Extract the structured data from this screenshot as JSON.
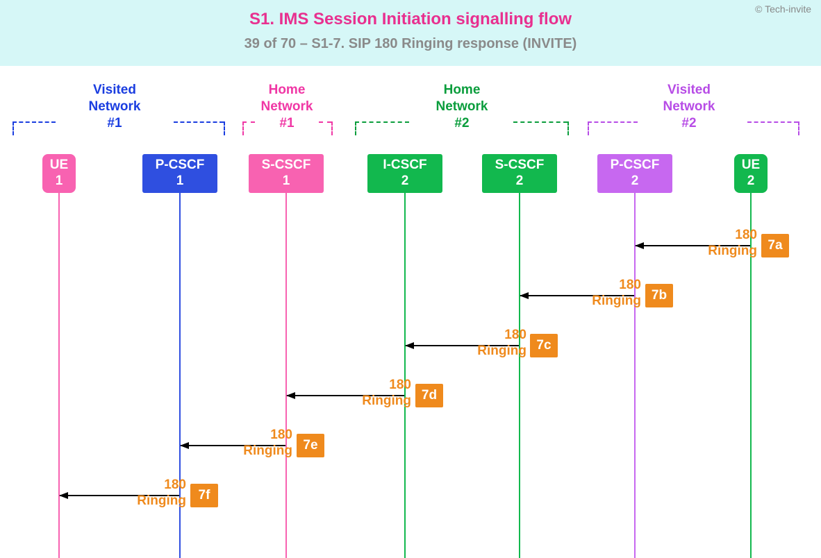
{
  "header": {
    "title": "S1. IMS Session Initiation signalling flow",
    "subtitle": "39 of 70 – S1-7. SIP 180 Ringing response (INVITE)",
    "copyright": "© Tech-invite"
  },
  "groups": {
    "visited1": {
      "line1": "Visited",
      "line2": "Network",
      "line3": "#1"
    },
    "home1": {
      "line1": "Home",
      "line2": "Network",
      "line3": "#1"
    },
    "home2": {
      "line1": "Home",
      "line2": "Network",
      "line3": "#2"
    },
    "visited2": {
      "line1": "Visited",
      "line2": "Network",
      "line3": "#2"
    }
  },
  "nodes": {
    "ue1": {
      "l1": "UE",
      "l2": "1"
    },
    "pcscf1": {
      "l1": "P-CSCF",
      "l2": "1"
    },
    "scscf1": {
      "l1": "S-CSCF",
      "l2": "1"
    },
    "icscf2": {
      "l1": "I-CSCF",
      "l2": "2"
    },
    "scscf2": {
      "l1": "S-CSCF",
      "l2": "2"
    },
    "pcscf2": {
      "l1": "P-CSCF",
      "l2": "2"
    },
    "ue2": {
      "l1": "UE",
      "l2": "2"
    }
  },
  "messages": {
    "a": {
      "top": "180",
      "bottom": "Ringing",
      "tag": "7a"
    },
    "b": {
      "top": "180",
      "bottom": "Ringing",
      "tag": "7b"
    },
    "c": {
      "top": "180",
      "bottom": "Ringing",
      "tag": "7c"
    },
    "d": {
      "top": "180",
      "bottom": "Ringing",
      "tag": "7d"
    },
    "e": {
      "top": "180",
      "bottom": "Ringing",
      "tag": "7e"
    },
    "f": {
      "top": "180",
      "bottom": "Ringing",
      "tag": "7f"
    }
  },
  "chart_data": {
    "type": "sequence-diagram",
    "lifelines": [
      {
        "id": "ue1",
        "label": "UE 1",
        "group": "Visited Network #1"
      },
      {
        "id": "pcscf1",
        "label": "P-CSCF 1",
        "group": "Visited Network #1"
      },
      {
        "id": "scscf1",
        "label": "S-CSCF 1",
        "group": "Home Network #1"
      },
      {
        "id": "icscf2",
        "label": "I-CSCF 2",
        "group": "Home Network #2"
      },
      {
        "id": "scscf2",
        "label": "S-CSCF 2",
        "group": "Home Network #2"
      },
      {
        "id": "pcscf2",
        "label": "P-CSCF 2",
        "group": "Visited Network #2"
      },
      {
        "id": "ue2",
        "label": "UE 2",
        "group": "Visited Network #2"
      }
    ],
    "messages": [
      {
        "id": "7a",
        "from": "ue2",
        "to": "pcscf2",
        "label": "180 Ringing"
      },
      {
        "id": "7b",
        "from": "pcscf2",
        "to": "scscf2",
        "label": "180 Ringing"
      },
      {
        "id": "7c",
        "from": "scscf2",
        "to": "icscf2",
        "label": "180 Ringing"
      },
      {
        "id": "7d",
        "from": "icscf2",
        "to": "scscf1",
        "label": "180 Ringing"
      },
      {
        "id": "7e",
        "from": "scscf1",
        "to": "pcscf1",
        "label": "180 Ringing"
      },
      {
        "id": "7f",
        "from": "pcscf1",
        "to": "ue1",
        "label": "180 Ringing"
      }
    ]
  }
}
